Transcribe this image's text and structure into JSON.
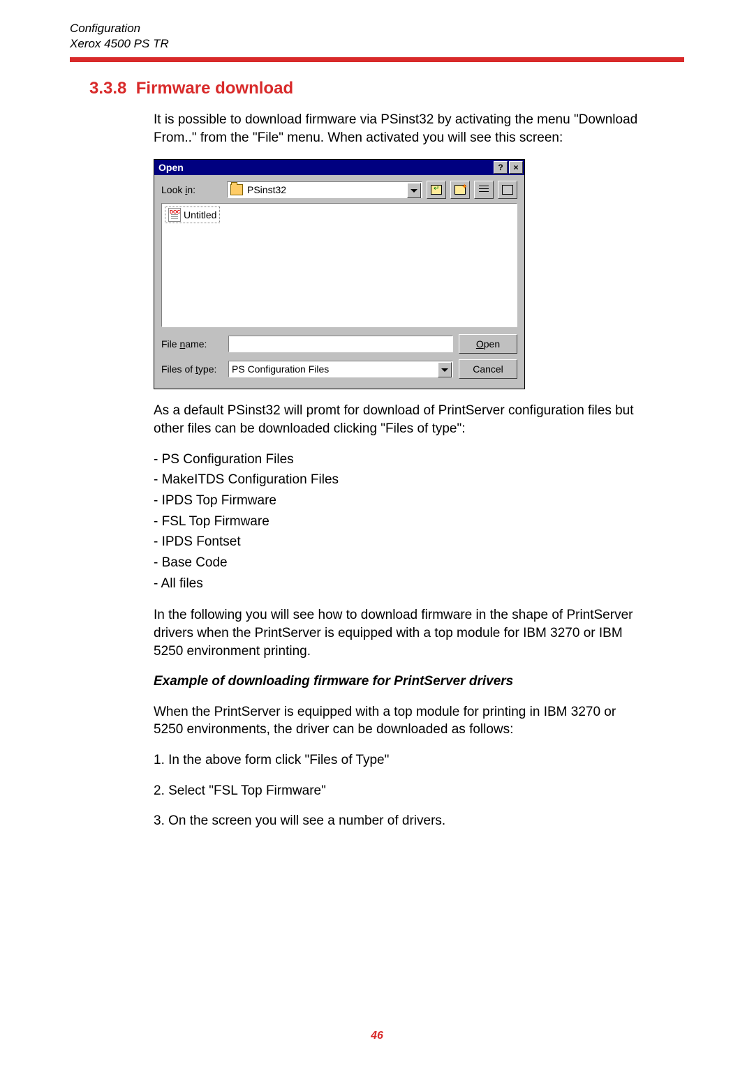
{
  "header": {
    "line1": "Configuration",
    "line2": "Xerox 4500 PS TR"
  },
  "section": {
    "number": "3.3.8",
    "title": "Firmware download"
  },
  "intro": "It is possible to download firmware via PSinst32 by activating the menu \"Download From..\" from the \"File\" menu.  When activated you will see this screen:",
  "dialog": {
    "title": "Open",
    "look_in_label": "Look in:",
    "look_in_value": "PSinst32",
    "file_item": "Untitled",
    "file_name_label": "File name:",
    "file_name_value": "",
    "files_of_type_label": "Files of type:",
    "files_of_type_value": "PS Configuration Files",
    "open_button": "Open",
    "cancel_button": "Cancel",
    "help_btn": "?",
    "close_btn": "×"
  },
  "after_dialog": "As a default PSinst32 will promt for download of PrintServer configuration files but other files can be downloaded clicking \"Files of type\":",
  "file_types": [
    "- PS Configuration Files",
    "- MakeITDS Configuration Files",
    "- IPDS Top Firmware",
    "- FSL Top Firmware",
    "- IPDS Fontset",
    "- Base Code",
    "- All files"
  ],
  "para2": "In the following you will see how to download firmware in the shape of PrintServer drivers when the PrintServer is equipped with a top module for IBM 3270 or IBM 5250 environment printing.",
  "example_heading": "Example of downloading firmware for PrintServer drivers",
  "para3": "When the PrintServer is equipped with a top module for printing in IBM 3270 or 5250 environments, the driver can be downloaded as follows:",
  "steps": [
    "1.  In the above form click \"Files of Type\"",
    "2.  Select \"FSL Top Firmware\"",
    "3.  On the screen you will see a number of drivers."
  ],
  "page_number": "46"
}
